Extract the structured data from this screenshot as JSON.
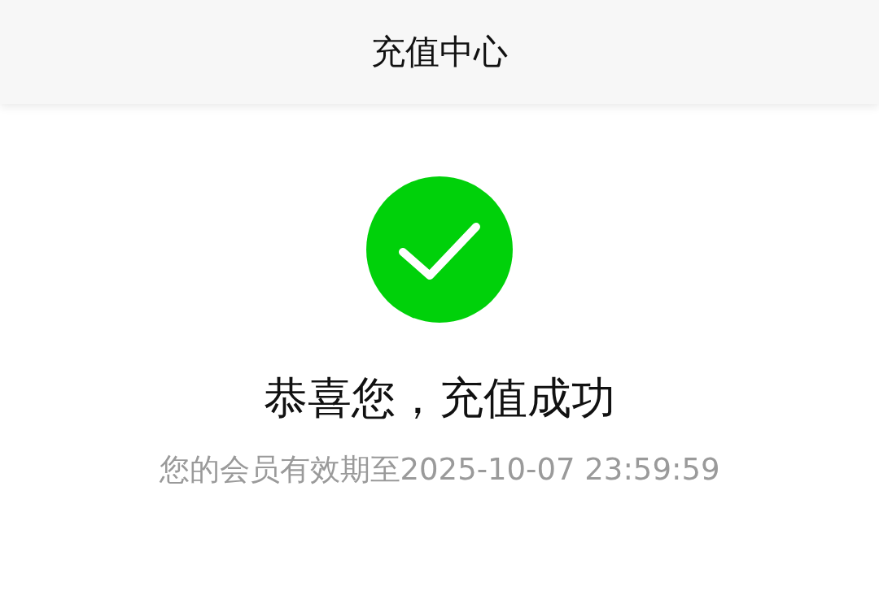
{
  "header": {
    "title": "充值中心"
  },
  "result": {
    "succeeded": true,
    "title": "恭喜您，充值成功",
    "detail": "您的会员有效期至2025-10-07 23:59:59"
  }
}
